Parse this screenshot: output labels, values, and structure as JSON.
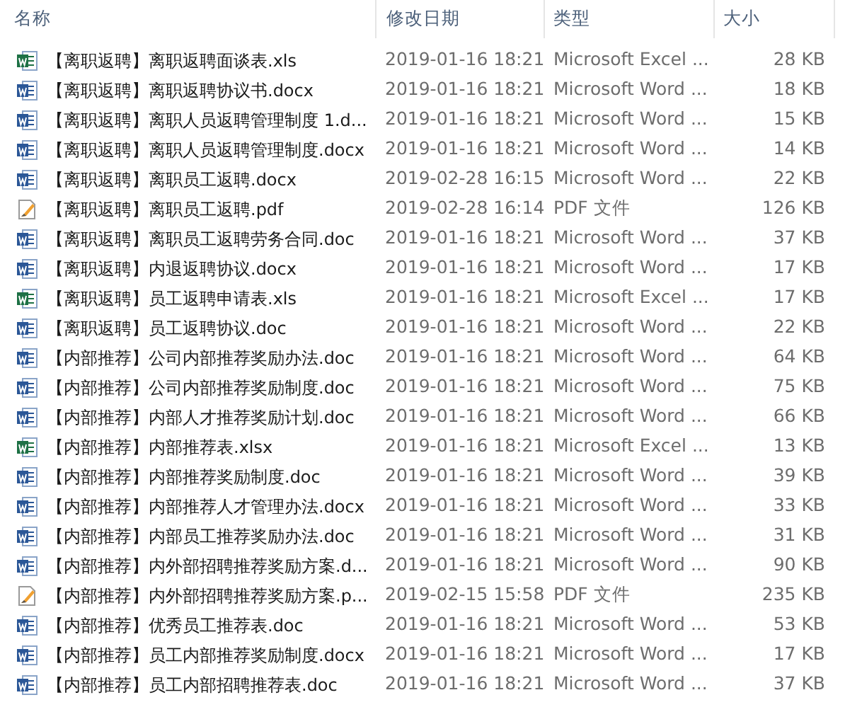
{
  "columns": [
    "名称",
    "修改日期",
    "类型",
    "大小"
  ],
  "files": [
    {
      "kind": "excel",
      "name": "【离职返聘】离职返聘面谈表.xls",
      "date": "2019-01-16 18:21",
      "type": "Microsoft Excel ...",
      "size": "28 KB"
    },
    {
      "kind": "word",
      "name": "【离职返聘】离职返聘协议书.docx",
      "date": "2019-01-16 18:21",
      "type": "Microsoft Word ...",
      "size": "18 KB"
    },
    {
      "kind": "word",
      "name": "【离职返聘】离职人员返聘管理制度 1.d...",
      "date": "2019-01-16 18:21",
      "type": "Microsoft Word ...",
      "size": "15 KB"
    },
    {
      "kind": "word",
      "name": "【离职返聘】离职人员返聘管理制度.docx",
      "date": "2019-01-16 18:21",
      "type": "Microsoft Word ...",
      "size": "14 KB"
    },
    {
      "kind": "word",
      "name": "【离职返聘】离职员工返聘.docx",
      "date": "2019-02-28 16:15",
      "type": "Microsoft Word ...",
      "size": "22 KB"
    },
    {
      "kind": "pdf",
      "name": "【离职返聘】离职员工返聘.pdf",
      "date": "2019-02-28 16:14",
      "type": "PDF 文件",
      "size": "126 KB"
    },
    {
      "kind": "word",
      "name": "【离职返聘】离职员工返聘劳务合同.doc",
      "date": "2019-01-16 18:21",
      "type": "Microsoft Word ...",
      "size": "37 KB"
    },
    {
      "kind": "word",
      "name": "【离职返聘】内退返聘协议.docx",
      "date": "2019-01-16 18:21",
      "type": "Microsoft Word ...",
      "size": "17 KB"
    },
    {
      "kind": "excel",
      "name": "【离职返聘】员工返聘申请表.xls",
      "date": "2019-01-16 18:21",
      "type": "Microsoft Excel ...",
      "size": "17 KB"
    },
    {
      "kind": "word",
      "name": "【离职返聘】员工返聘协议.doc",
      "date": "2019-01-16 18:21",
      "type": "Microsoft Word ...",
      "size": "22 KB"
    },
    {
      "kind": "word",
      "name": "【内部推荐】公司内部推荐奖励办法.doc",
      "date": "2019-01-16 18:21",
      "type": "Microsoft Word ...",
      "size": "64 KB"
    },
    {
      "kind": "word",
      "name": "【内部推荐】公司内部推荐奖励制度.doc",
      "date": "2019-01-16 18:21",
      "type": "Microsoft Word ...",
      "size": "75 KB"
    },
    {
      "kind": "word",
      "name": "【内部推荐】内部人才推荐奖励计划.doc",
      "date": "2019-01-16 18:21",
      "type": "Microsoft Word ...",
      "size": "66 KB"
    },
    {
      "kind": "excel",
      "name": "【内部推荐】内部推荐表.xlsx",
      "date": "2019-01-16 18:21",
      "type": "Microsoft Excel ...",
      "size": "13 KB"
    },
    {
      "kind": "word",
      "name": "【内部推荐】内部推荐奖励制度.doc",
      "date": "2019-01-16 18:21",
      "type": "Microsoft Word ...",
      "size": "39 KB"
    },
    {
      "kind": "word",
      "name": "【内部推荐】内部推荐人才管理办法.docx",
      "date": "2019-01-16 18:21",
      "type": "Microsoft Word ...",
      "size": "33 KB"
    },
    {
      "kind": "word",
      "name": "【内部推荐】内部员工推荐奖励办法.doc",
      "date": "2019-01-16 18:21",
      "type": "Microsoft Word ...",
      "size": "31 KB"
    },
    {
      "kind": "word",
      "name": "【内部推荐】内外部招聘推荐奖励方案.d...",
      "date": "2019-01-16 18:21",
      "type": "Microsoft Word ...",
      "size": "90 KB"
    },
    {
      "kind": "pdf",
      "name": "【内部推荐】内外部招聘推荐奖励方案.p...",
      "date": "2019-02-15 15:58",
      "type": "PDF 文件",
      "size": "235 KB"
    },
    {
      "kind": "word",
      "name": "【内部推荐】优秀员工推荐表.doc",
      "date": "2019-01-16 18:21",
      "type": "Microsoft Word ...",
      "size": "53 KB"
    },
    {
      "kind": "word",
      "name": "【内部推荐】员工内部推荐奖励制度.docx",
      "date": "2019-01-16 18:21",
      "type": "Microsoft Word ...",
      "size": "17 KB"
    },
    {
      "kind": "word",
      "name": "【内部推荐】员工内部招聘推荐表.doc",
      "date": "2019-01-16 18:21",
      "type": "Microsoft Word ...",
      "size": "37 KB"
    }
  ]
}
